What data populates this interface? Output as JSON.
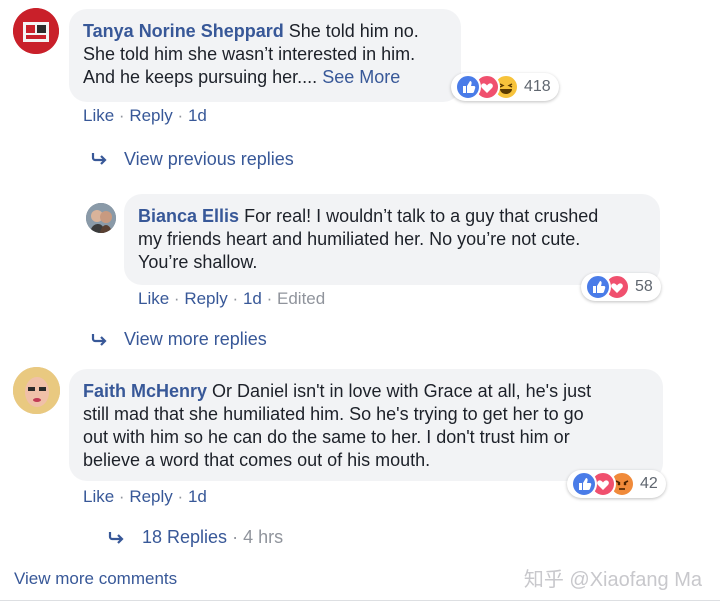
{
  "comments": [
    {
      "author": "Tanya Norine Sheppard",
      "text_lines": [
        "She told him no.",
        "She told him she wasn’t interested in him.",
        "And he keeps pursuing her...."
      ],
      "see_more": "See More",
      "reaction_count": "418",
      "reactions": [
        "like-icon",
        "love-icon",
        "haha-icon"
      ],
      "actions": {
        "like": "Like",
        "reply": "Reply",
        "time": "1d"
      },
      "view_replies": "View previous replies"
    },
    {
      "author": "Bianca Ellis",
      "text_lines": [
        "For real! I wouldn’t talk to a guy that crushed",
        "my friends heart and humiliated her. No you’re not cute.",
        "You’re shallow."
      ],
      "reaction_count": "58",
      "reactions": [
        "like-icon",
        "love-icon"
      ],
      "actions": {
        "like": "Like",
        "reply": "Reply",
        "time": "1d",
        "edited": "Edited"
      },
      "view_replies": "View more replies"
    },
    {
      "author": "Faith McHenry",
      "text_lines": [
        "Or Daniel isn't in love with Grace at all, he's just",
        "still mad that she humiliated him. So he's trying to get her to go",
        "out with him so he can do the same to her. I don't trust him or",
        "believe a word that comes out of his mouth."
      ],
      "reaction_count": "42",
      "reactions": [
        "like-icon",
        "love-icon",
        "angry-icon"
      ],
      "actions": {
        "like": "Like",
        "reply": "Reply",
        "time": "1d"
      },
      "replies_link": "18 Replies",
      "replies_time": "4 hrs"
    }
  ],
  "footer": {
    "view_more_comments": "View more comments",
    "watermark": "知乎 @Xiaofang Ma"
  },
  "colors": {
    "link": "#385898",
    "bubble": "#f2f3f5",
    "meta": "#90949c",
    "like": "#4a7ce8",
    "love": "#f0506e"
  }
}
